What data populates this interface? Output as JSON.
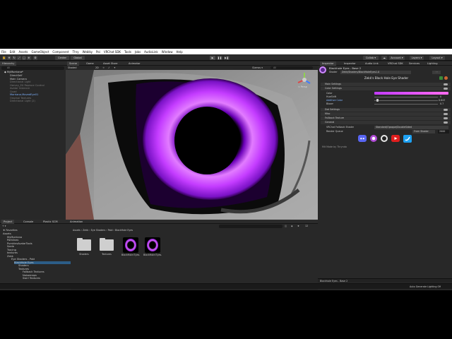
{
  "menu": [
    "File",
    "Edit",
    "Assets",
    "GameObject",
    "Component",
    "Thry",
    "Weblky",
    "Poi",
    "VRChat SDK",
    "Tools",
    "Jobs",
    "AudioLink",
    "Window",
    "Help"
  ],
  "toolbar": {
    "center": "Center",
    "global": "Global",
    "collab": "Collab ▾",
    "account": "Account ▾",
    "layers": "Layers ▾",
    "layout": "Layout ▾"
  },
  "hierarchy": {
    "tab": "Hierarchy",
    "search_placeholder": "All",
    "items": [
      "MyMorriana*",
      "DirectSelf",
      "Main Camera",
      "Directional Light",
      "Harvey_EX Replace Control",
      "Avatar Instance",
      "Quad",
      "Morriana-MovedEye01",
      "Original Textures",
      "Directional Light (2)"
    ]
  },
  "scene_tabs": [
    "Scene",
    "Game",
    "Asset Store",
    "Animator"
  ],
  "scene": {
    "shading": "Shaded",
    "mode": "2D",
    "gizmos": "Gizmos ▾",
    "search": "All",
    "persp": "< Persp"
  },
  "inspector": {
    "tabs": [
      "Inspector",
      "Inspector",
      "Audio Link",
      "VRChat SDK",
      "Services",
      "Lighting"
    ],
    "object_name": "Blackhole Eyes - Base 2",
    "shader_label": "Shader",
    "shader_value": "Zekk/Shaders/BlackHoleEyes1.0",
    "title": "Zekk's Black Hole Eye Shader",
    "sections": [
      "Main Settings",
      "Color Settings",
      "Dot Settings",
      "Misc",
      "Fallback Texture",
      "General"
    ],
    "props": [
      {
        "label": "Color",
        "value": ""
      },
      {
        "label": "HueShift",
        "value": "0"
      },
      {
        "label": "Additive Color",
        "value": "0.843"
      },
      {
        "label": "Bloom",
        "value": "0.7"
      }
    ],
    "fallback_label": "VRChat Fallback Shader",
    "fallback_value": "Standard/Opaque/DoubleSided",
    "render_queue_label": "Render Queue",
    "render_queue_mode": "From Shader",
    "render_queue_value": "2000",
    "credit": "Mit Made by Thryndo",
    "footer": "Blackhole Eyes - Base 2",
    "social_colors": [
      "#5865f2",
      "#b04bd6",
      "#e8e8e8",
      "#e01e1e",
      "#1da1f2"
    ]
  },
  "project": {
    "tabs": [
      "Project",
      "Console",
      "Plastic SCM",
      "Animation"
    ],
    "tree": [
      "Favorites",
      "Assets",
      "MyMorriana",
      "Pathlines",
      "PumkinsAvatarTools",
      "Seele",
      "Tracing",
      "textures",
      "Zekk",
      "Eye Shaders - Paid",
      "BlackHole Eyes",
      "Shaders",
      "Textures",
      "Fallback Textures",
      "Noisemaps",
      "Swirl Textures"
    ],
    "breadcrumb": [
      "Assets",
      "Zekk",
      "Eye Shaders",
      "Paid",
      "BlackHole Eyes"
    ],
    "files": [
      "Shaders",
      "Textures",
      "BlackHole Eyes...",
      "BlackHole Eyes..."
    ],
    "path": "Assets/Zekk/Eye Shaders - Paid/BlackHole Eyes/Textures/Swirl Textures/TexSwirl10.png",
    "count": "12"
  },
  "status": "Auto Generate Lighting Off",
  "colors": {
    "accent": "#b83bd6",
    "bg": "#1f1f1f",
    "panel": "#282828"
  }
}
